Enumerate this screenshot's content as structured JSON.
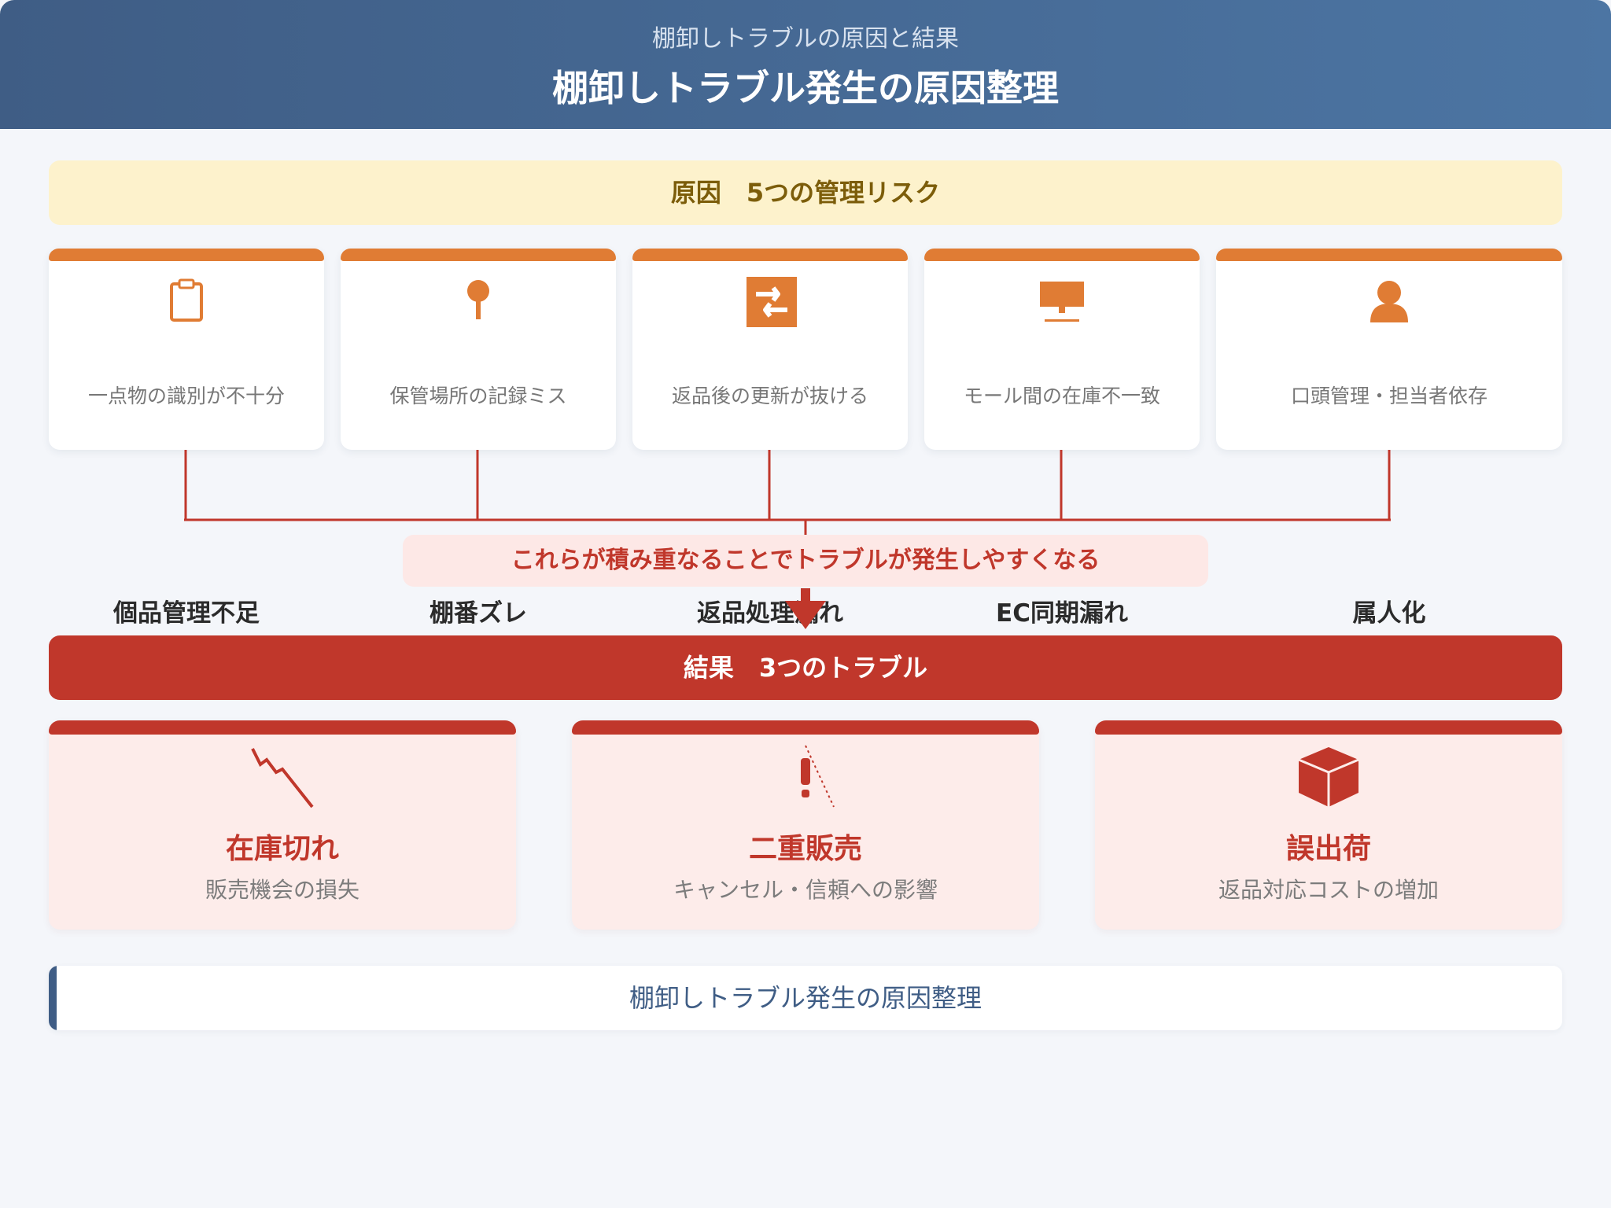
{
  "header": {
    "subtitle": "棚卸しトラブルの原因と結果",
    "title": "棚卸しトラブル発生の原因整理"
  },
  "causes": {
    "banner": "原因　5つの管理リスク",
    "items": [
      {
        "title": "個品管理不足",
        "desc": "一点物の識別が不十分",
        "icon": "clipboard-icon"
      },
      {
        "title": "棚番ズレ",
        "desc": "保管場所の記録ミス",
        "icon": "pin-icon"
      },
      {
        "title": "返品処理漏れ",
        "desc": "返品後の更新が抜ける",
        "icon": "return-arrows-icon"
      },
      {
        "title": "EC同期漏れ",
        "desc": "モール間の在庫不一致",
        "icon": "monitor-icon"
      },
      {
        "title": "属人化",
        "desc": "口頭管理・担当者依存",
        "icon": "person-icon"
      }
    ]
  },
  "merge_note": "これらが積み重なることでトラブルが発生しやすくなる",
  "results": {
    "banner": "結果　3つのトラブル",
    "items": [
      {
        "title": "在庫切れ",
        "desc": "販売機会の損失",
        "icon": "falling-chart-icon"
      },
      {
        "title": "二重販売",
        "desc": "キャンセル・信頼への影響",
        "icon": "warning-icon"
      },
      {
        "title": "誤出荷",
        "desc": "返品対応コストの増加",
        "icon": "package-icon"
      }
    ]
  },
  "footer_note": "棚卸しトラブル発生の原因整理",
  "colors": {
    "header": "#3f5d85",
    "cause_accent": "#e07c34",
    "result_accent": "#c0372b",
    "cause_banner_bg": "#fdf2cc",
    "result_card_bg": "#fdecea"
  }
}
